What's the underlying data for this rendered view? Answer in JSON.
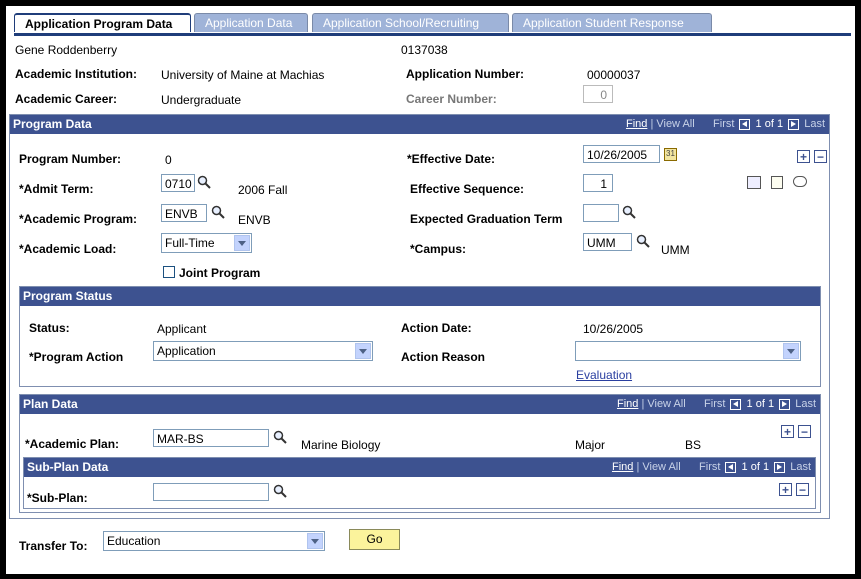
{
  "tabs": [
    "Application Program Data",
    "Application Data",
    "Application School/Recruiting",
    "Application Student Response"
  ],
  "header": {
    "person_name": "Gene Roddenberry",
    "person_id": "0137038",
    "institution_label": "Academic Institution:",
    "institution_value": "University of Maine at Machias",
    "app_number_label": "Application Number:",
    "app_number_value": "00000037",
    "career_label": "Academic Career:",
    "career_value": "Undergraduate",
    "career_number_label": "Career Number:",
    "career_number_value": "0"
  },
  "program_data": {
    "title": "Program Data",
    "nav": {
      "find": "Find",
      "sep": "|",
      "view_all": "View All",
      "first": "First",
      "count": "1 of 1",
      "last": "Last"
    },
    "program_number_label": "Program Number:",
    "program_number_value": "0",
    "effective_date_label": "*Effective Date:",
    "effective_date_value": "10/26/2005",
    "admit_term_label": "*Admit Term:",
    "admit_term_value": "0710",
    "admit_term_desc": "2006 Fall",
    "eff_seq_label": "Effective Sequence:",
    "eff_seq_value": "1",
    "acad_program_label": "*Academic Program:",
    "acad_program_value": "ENVB",
    "acad_program_desc": "ENVB",
    "exp_grad_label": "Expected Graduation Term",
    "exp_grad_value": "",
    "acad_load_label": "*Academic Load:",
    "acad_load_value": "Full-Time",
    "campus_label": "*Campus:",
    "campus_value": "UMM",
    "campus_desc": "UMM",
    "joint_program_label": "Joint Program"
  },
  "program_status": {
    "title": "Program Status",
    "status_label": "Status:",
    "status_value": "Applicant",
    "action_date_label": "Action Date:",
    "action_date_value": "10/26/2005",
    "program_action_label": "*Program Action",
    "program_action_value": "Application",
    "action_reason_label": "Action Reason",
    "action_reason_value": "",
    "evaluation_link": "Evaluation"
  },
  "plan_data": {
    "title": "Plan Data",
    "nav": {
      "find": "Find",
      "sep": "|",
      "view_all": "View All",
      "first": "First",
      "count": "1 of 1",
      "last": "Last"
    },
    "academic_plan_label": "*Academic Plan:",
    "academic_plan_value": "MAR-BS",
    "academic_plan_desc": "Marine Biology",
    "plan_type": "Major",
    "plan_degree": "BS"
  },
  "sub_plan_data": {
    "title": "Sub-Plan Data",
    "nav": {
      "find": "Find",
      "sep": "|",
      "view_all": "View All",
      "first": "First",
      "count": "1 of 1",
      "last": "Last"
    },
    "sub_plan_label": "*Sub-Plan:",
    "sub_plan_value": ""
  },
  "footer": {
    "transfer_label": "Transfer To:",
    "transfer_value": "Education",
    "go_label": "Go"
  },
  "colors": {
    "section_header": "#3d5290",
    "tab_inactive": "#9fb3d8",
    "go_button": "#fbf39c"
  }
}
